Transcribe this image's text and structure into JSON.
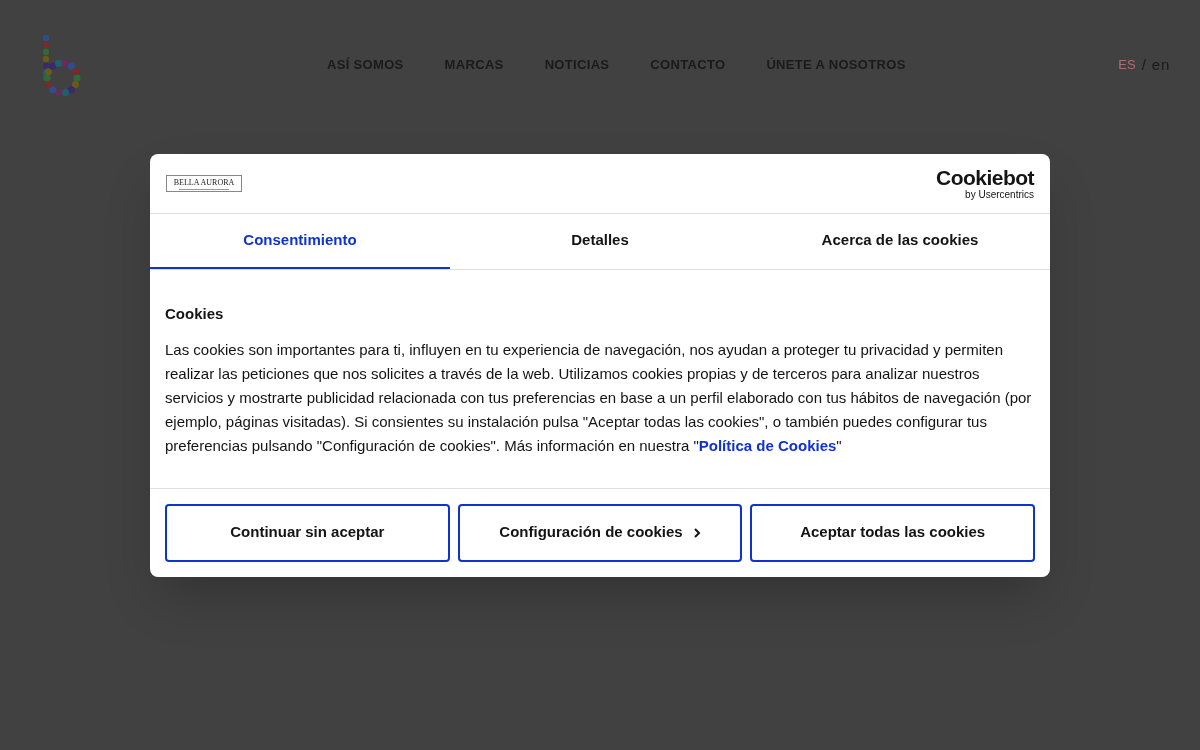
{
  "nav": {
    "items": [
      {
        "label": "ASÍ SOMOS"
      },
      {
        "label": "MARCAS"
      },
      {
        "label": "NOTICIAS"
      },
      {
        "label": "CONTACTO"
      },
      {
        "label": "ÚNETE A NOSOTROS"
      }
    ],
    "languages": [
      {
        "label": "ES",
        "selected": true
      },
      {
        "label": "en",
        "selected": false
      }
    ],
    "separator": "/"
  },
  "dialog": {
    "brand_logo": "BELLA AURORA",
    "provider": {
      "name": "Cookiebot",
      "byline": "by Usercentrics"
    },
    "tabs": [
      {
        "label": "Consentimiento",
        "selected": true
      },
      {
        "label": "Detalles",
        "selected": false
      },
      {
        "label": "Acerca de las cookies",
        "selected": false
      }
    ],
    "heading": "Cookies",
    "body": {
      "text": "Las cookies son importantes para ti, influyen en tu experiencia de navegación, nos ayudan a proteger tu privacidad y permiten realizar las peticiones que nos solicites a través de la web. Utilizamos cookies propias y de terceros para analizar nuestros servicios y mostrarte publicidad relacionada con tus preferencias en base a un perfil elaborado con tus hábitos de navegación (por ejemplo, páginas visitadas). Si consientes su instalación pulsa \"Aceptar todas las cookies\", o también puedes configurar tus preferencias pulsando \"Configuración de cookies\". Más información en nuestra \"",
      "link": "Política de Cookies",
      "after": "\""
    },
    "buttons": [
      {
        "label": "Continuar sin aceptar",
        "kind": "plain"
      },
      {
        "label": "Configuración de cookies",
        "kind": "chevron"
      },
      {
        "label": "Aceptar todas las cookies",
        "kind": "plain"
      }
    ]
  }
}
